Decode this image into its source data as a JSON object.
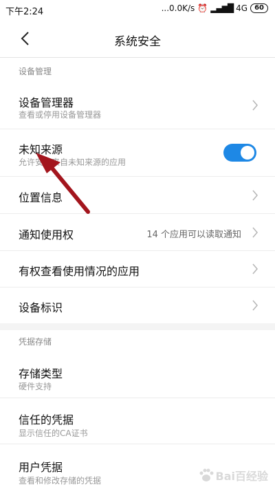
{
  "status_bar": {
    "time": "下午2:24",
    "network_speed": "...0.0K/s",
    "network_type": "4G",
    "battery": "60"
  },
  "nav": {
    "title": "系统安全"
  },
  "sections": {
    "device_management": "设备管理",
    "credential_storage": "凭据存储"
  },
  "items": {
    "device_admins": {
      "title": "设备管理器",
      "subtitle": "查看或停用设备管理器"
    },
    "unknown_sources": {
      "title": "未知来源",
      "subtitle": "允许安装来自未知来源的应用",
      "enabled": true
    },
    "location": {
      "title": "位置信息"
    },
    "notification_access": {
      "title": "通知使用权",
      "detail": "14 个应用可以读取通知"
    },
    "usage_access": {
      "title": "有权查看使用情况的应用"
    },
    "device_id": {
      "title": "设备标识"
    },
    "storage_type": {
      "title": "存储类型",
      "subtitle": "硬件支持"
    },
    "trusted_credentials": {
      "title": "信任的凭据",
      "subtitle": "显示信任的CA证书"
    },
    "user_credentials": {
      "title": "用户凭据",
      "subtitle": "查看和修改存储的凭据"
    }
  },
  "colors": {
    "accent": "#1e88e5",
    "annotation_arrow": "#a3151d"
  },
  "watermark": {
    "text": "Bai百经验"
  }
}
